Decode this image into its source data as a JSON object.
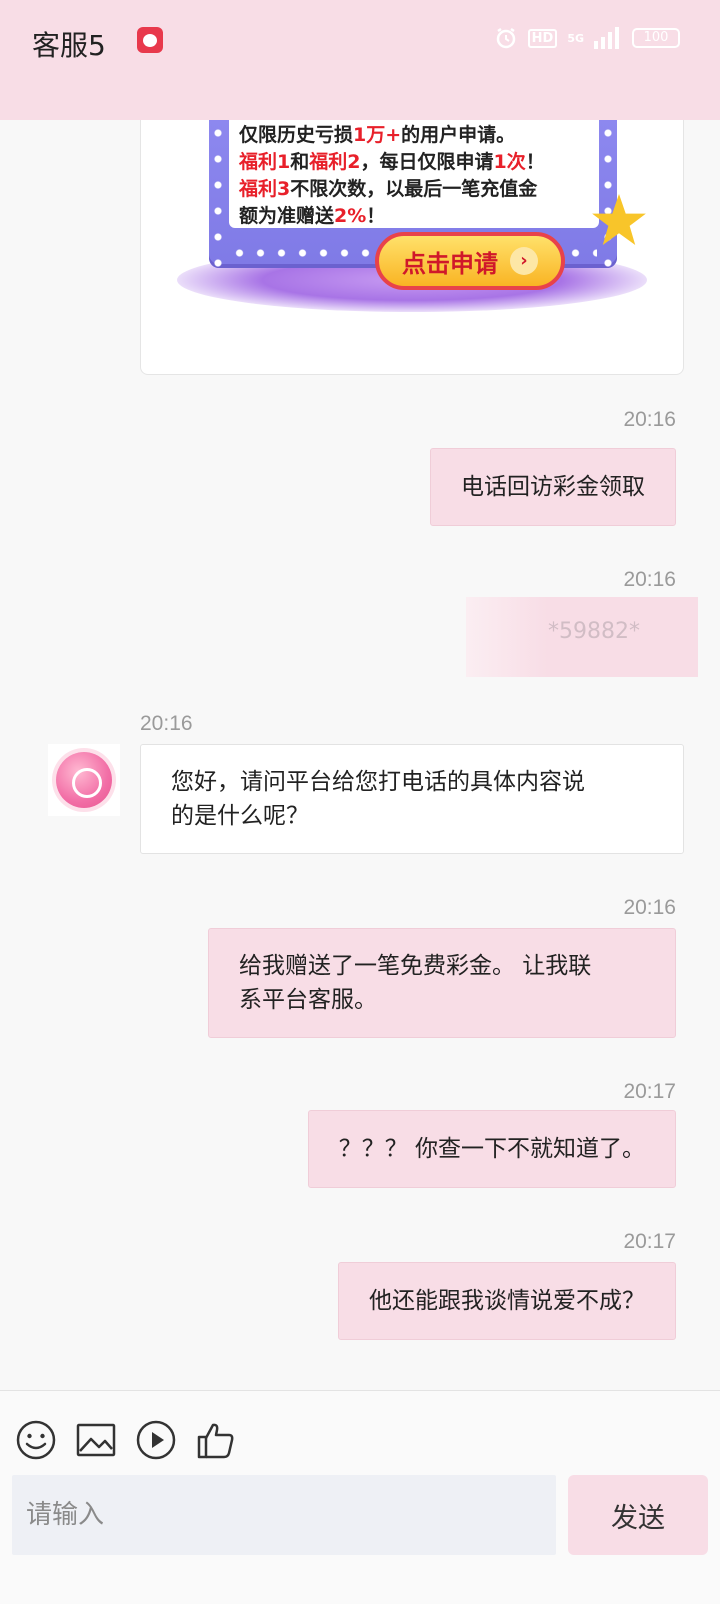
{
  "status_bar": {
    "title": "客服5",
    "hd_label": "HD",
    "network_label": "5G",
    "battery": "100"
  },
  "promo": {
    "line1_prefix": "仅限历史亏损",
    "line1_highlight": "1万+",
    "line1_suffix": "的用户申请。",
    "line2_a": "福利1",
    "line2_b": "和",
    "line2_c": "福利2",
    "line2_d": "，每日仅限申请",
    "line2_e": "1次",
    "line2_f": "！",
    "line3_a": "福利3",
    "line3_b": "不限次数，以最后一笔充值金",
    "line4_a": "额为准赠送",
    "line4_b": "2%",
    "line4_c": "！",
    "apply_label": "点击申请",
    "chevron": "›"
  },
  "messages": [
    {
      "time": "20:16",
      "text": "电话回访彩金领取",
      "side": "out"
    },
    {
      "time": "20:16",
      "text": "*59882*",
      "side": "out",
      "redacted": true
    },
    {
      "time": "20:16",
      "text_line1": "您好，请问平台给您打电话的具体内容说",
      "text_line2": "的是什么呢？",
      "side": "in"
    },
    {
      "time": "20:16",
      "text_line1": "给我赠送了一笔免费彩金。 让我联",
      "text_line2": "系平台客服。",
      "side": "out"
    },
    {
      "time": "20:17",
      "text": "？？？ 你查一下不就知道了。",
      "side": "out"
    },
    {
      "time": "20:17",
      "text": "他还能跟我谈情说爱不成？",
      "side": "out"
    }
  ],
  "composer": {
    "placeholder": "请输入",
    "send_label": "发送"
  },
  "colors": {
    "accent_pink": "#f8dde6",
    "background": "#f8f8f8",
    "input_bg": "#eef0f5"
  },
  "icons": [
    "emoji-icon",
    "image-icon",
    "video-icon",
    "thumbs-up-icon",
    "alarm-icon",
    "signal-icon"
  ]
}
